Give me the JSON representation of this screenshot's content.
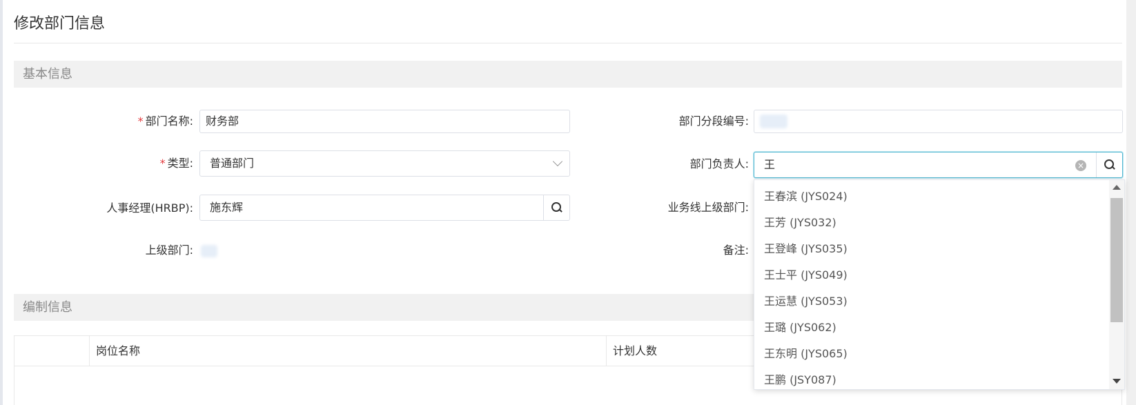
{
  "page": {
    "title": "修改部门信息"
  },
  "sections": {
    "basic": "基本信息",
    "staffing": "编制信息"
  },
  "form": {
    "dept_name": {
      "label": "部门名称:",
      "value": "财务部",
      "required_mark": "*"
    },
    "type": {
      "label": "类型:",
      "value": "普通部门",
      "required_mark": "*"
    },
    "hrbp": {
      "label": "人事经理(HRBP):",
      "value": "施东辉"
    },
    "parent_dept": {
      "label": "上级部门:"
    },
    "segment_code": {
      "label": "部门分段编号:"
    },
    "manager": {
      "label": "部门负责人:",
      "value": "王"
    },
    "biz_parent": {
      "label": "业务线上级部门:"
    },
    "remark": {
      "label": "备注:"
    }
  },
  "table": {
    "headers": [
      "",
      "岗位名称",
      "计划人数"
    ]
  },
  "dropdown": {
    "options": [
      "王春滨 (JYS024)",
      "王芳 (JYS032)",
      "王登峰 (JYS035)",
      "王士平 (JYS049)",
      "王运慧 (JYS053)",
      "王璐 (JYS062)",
      "王东明 (JYS065)",
      "王鹏 (JSY087)"
    ]
  },
  "colors": {
    "focus_border": "#4fb6d0",
    "required": "#e4393c",
    "section_bg": "#f1f1f1"
  }
}
